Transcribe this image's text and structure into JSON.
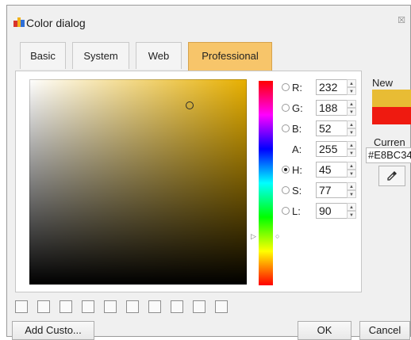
{
  "window": {
    "title": "Color dialog"
  },
  "icons": {
    "app": "color-palette-icon",
    "close": "close-icon",
    "eyedropper": "eyedropper-icon",
    "spin_up": "spin-up-icon",
    "spin_down": "spin-down-icon"
  },
  "tabs": [
    {
      "label": "Basic",
      "active": false
    },
    {
      "label": "System",
      "active": false
    },
    {
      "label": "Web",
      "active": false
    },
    {
      "label": "Professional",
      "active": true
    }
  ],
  "picker": {
    "base_hue_color": "#e8b000",
    "fields": [
      {
        "label": "R:",
        "value": "232",
        "has_radio": true,
        "checked": false
      },
      {
        "label": "G:",
        "value": "188",
        "has_radio": true,
        "checked": false
      },
      {
        "label": "B:",
        "value": "52",
        "has_radio": true,
        "checked": false
      },
      {
        "label": "A:",
        "value": "255",
        "has_radio": false,
        "checked": false
      },
      {
        "label": "H:",
        "value": "45",
        "has_radio": true,
        "checked": true
      },
      {
        "label": "S:",
        "value": "77",
        "has_radio": true,
        "checked": false
      },
      {
        "label": "L:",
        "value": "90",
        "has_radio": true,
        "checked": false
      }
    ]
  },
  "preview": {
    "new_label": "New",
    "new_color": "#e8bc34",
    "current_label": "Curren",
    "current_color": "#ef1a10",
    "hex_value": "#E8BC34"
  },
  "custom_colors": {
    "count": 10
  },
  "buttons": {
    "add_custom": "Add Custo...",
    "ok": "OK",
    "cancel": "Cancel"
  },
  "colors": {
    "active_tab": "#f7c56a",
    "window_bg": "#f0f0f0"
  }
}
